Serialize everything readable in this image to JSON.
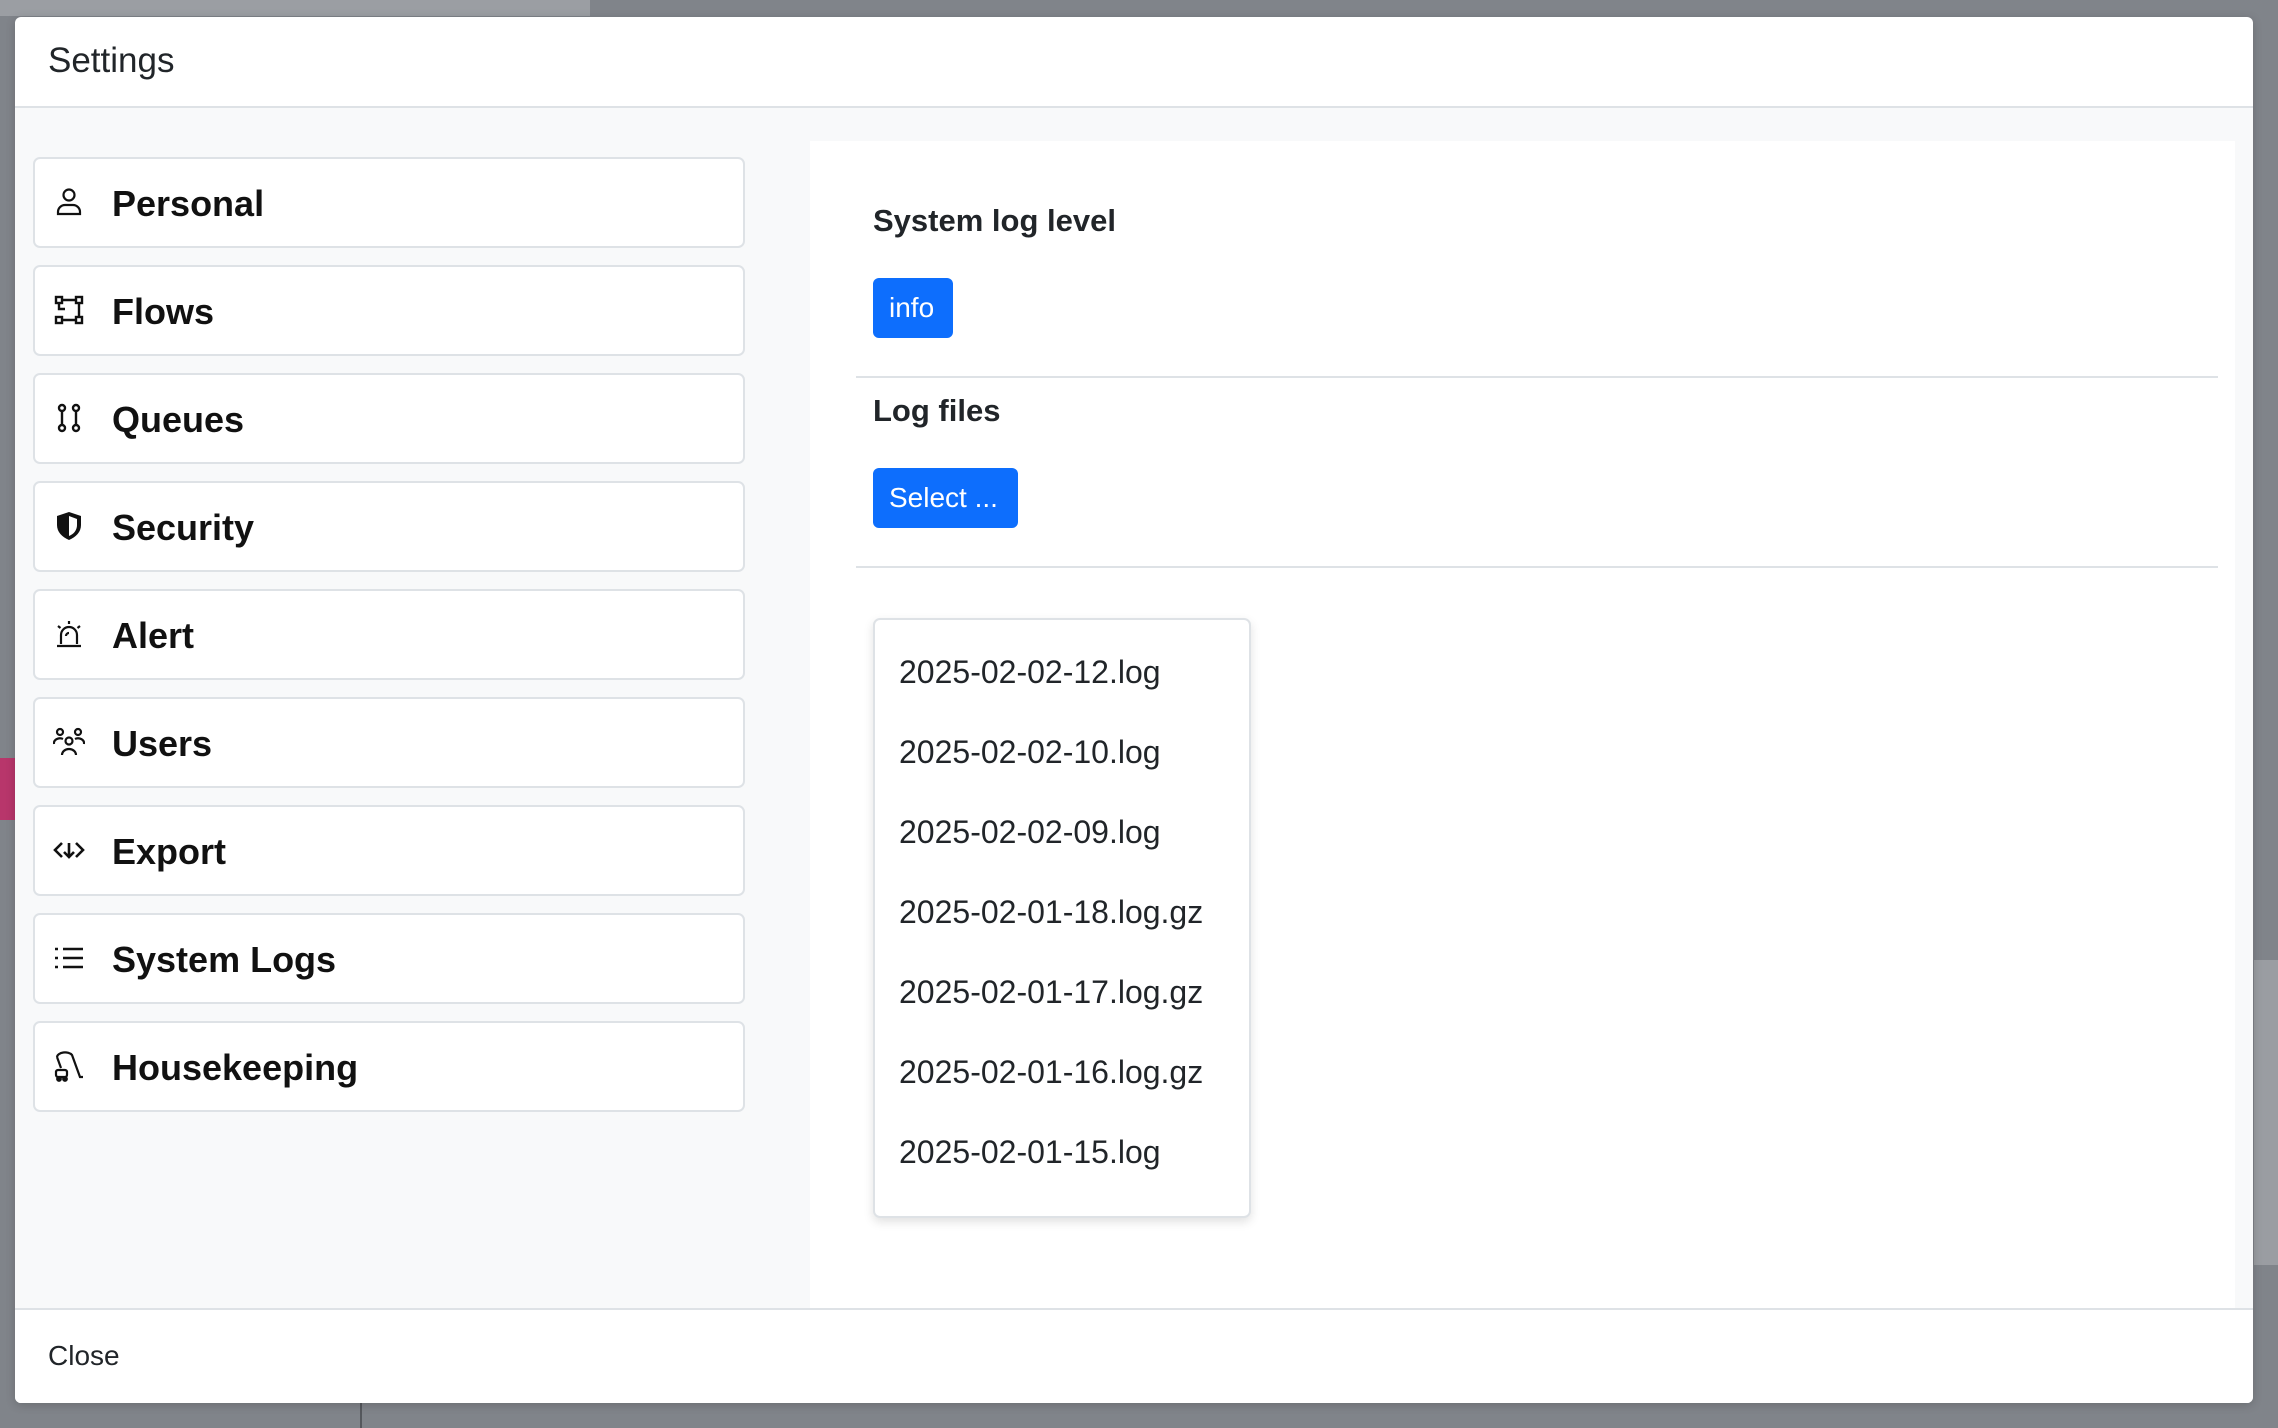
{
  "modal": {
    "title": "Settings",
    "close_label": "Close"
  },
  "sidebar": {
    "items": [
      {
        "label": "Personal",
        "icon": "person-icon"
      },
      {
        "label": "Flows",
        "icon": "flows-icon"
      },
      {
        "label": "Queues",
        "icon": "queues-icon"
      },
      {
        "label": "Security",
        "icon": "shield-icon"
      },
      {
        "label": "Alert",
        "icon": "alarm-icon"
      },
      {
        "label": "Users",
        "icon": "users-icon"
      },
      {
        "label": "Export",
        "icon": "export-icon"
      },
      {
        "label": "System Logs",
        "icon": "list-icon"
      },
      {
        "label": "Housekeeping",
        "icon": "vacuum-icon"
      }
    ]
  },
  "content": {
    "log_level": {
      "title": "System log level",
      "value": "info"
    },
    "log_files": {
      "title": "Log files",
      "select_label": "Select ...",
      "options": [
        "2025-02-02-12.log",
        "2025-02-02-10.log",
        "2025-02-02-09.log",
        "2025-02-01-18.log.gz",
        "2025-02-01-17.log.gz",
        "2025-02-01-16.log.gz",
        "2025-02-01-15.log"
      ]
    }
  },
  "colors": {
    "primary": "#0d6efd",
    "border": "#dee2e6",
    "body_bg": "#f8f9fa"
  }
}
